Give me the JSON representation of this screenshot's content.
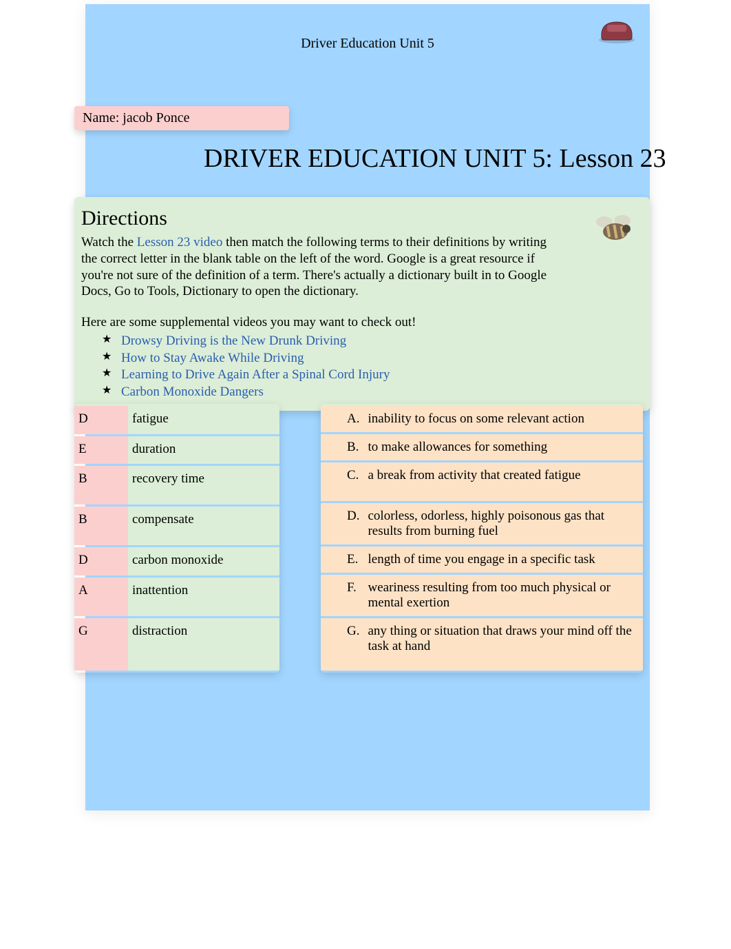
{
  "header": {
    "small_title": "Driver Education Unit 5",
    "name_line": "Name: jacob Ponce",
    "big_title": "DRIVER EDUCATION UNIT 5: Lesson 23"
  },
  "directions": {
    "title": "Directions",
    "pre_link": "Watch the ",
    "video_link_text": "Lesson 23 video",
    "post_link": " then match the following terms to their definitions by writing the correct letter in the blank table on the left of the word. Google is a great resource if you're not sure of the definition of a term. There's actually a dictionary built in to Google Docs, Go to Tools, Dictionary to open the dictionary.",
    "supp_intro": "Here are some supplemental videos you may want to check out!",
    "links": [
      "Drowsy Driving is the New Drunk Driving",
      "How to Stay Awake While Driving",
      "Learning to Drive Again After a Spinal Cord Injury",
      "Carbon Monoxide Dangers"
    ]
  },
  "terms": [
    {
      "answer": "D",
      "term": "fatigue"
    },
    {
      "answer": "E",
      "term": "duration"
    },
    {
      "answer": "B",
      "term": "recovery time"
    },
    {
      "answer": "B",
      "term": "compensate"
    },
    {
      "answer": "D",
      "term": "carbon monoxide"
    },
    {
      "answer": "A",
      "term": "inattention"
    },
    {
      "answer": "G",
      "term": "distraction"
    }
  ],
  "definitions": [
    {
      "letter": "A.",
      "text": "inability to focus on some relevant action"
    },
    {
      "letter": "B.",
      "text": "to make allowances for something"
    },
    {
      "letter": "C.",
      "text": "a break from activity that created fatigue"
    },
    {
      "letter": "D.",
      "text": "colorless, odorless, highly poisonous gas that results from burning fuel"
    },
    {
      "letter": "E.",
      "text": "length of time you engage in a specific task"
    },
    {
      "letter": "F.",
      "text": "weariness resulting from too much physical or mental exertion"
    },
    {
      "letter": "G.",
      "text": "any thing or situation that draws your mind off the task at hand"
    }
  ]
}
